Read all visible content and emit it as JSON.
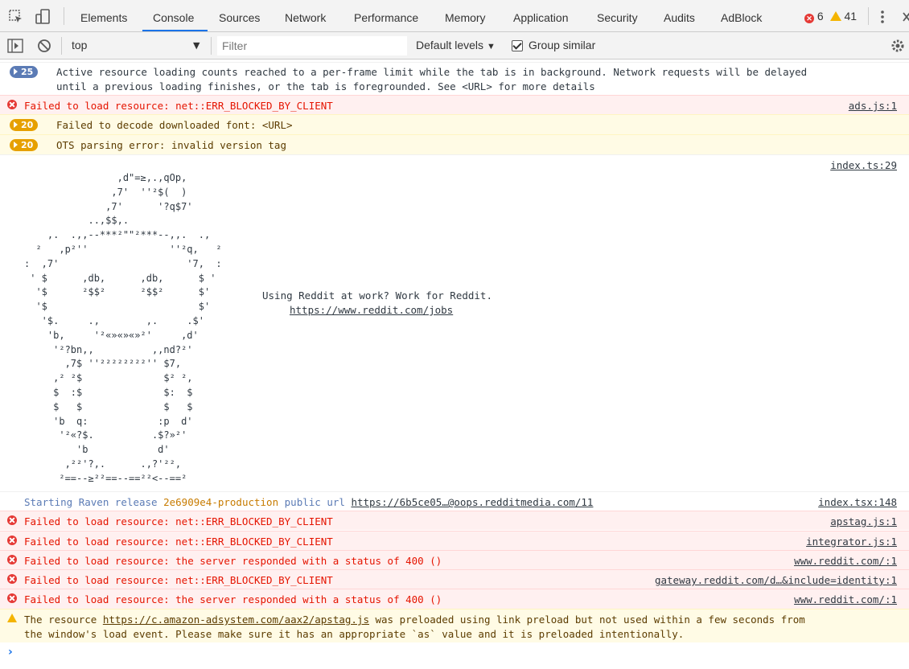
{
  "tabs": [
    {
      "label": "Elements"
    },
    {
      "label": "Console"
    },
    {
      "label": "Sources"
    },
    {
      "label": "Network"
    },
    {
      "label": "Performance"
    },
    {
      "label": "Memory"
    },
    {
      "label": "Application"
    },
    {
      "label": "Security"
    },
    {
      "label": "Audits"
    },
    {
      "label": "AdBlock"
    }
  ],
  "active_tab": "Console",
  "counts": {
    "errors": "6",
    "warnings": "41"
  },
  "toolbar": {
    "context": "top",
    "filter_placeholder": "Filter",
    "levels": "Default levels",
    "group_similar": "Group similar",
    "group_similar_checked": true
  },
  "messages": {
    "m1": {
      "count": "25",
      "text": "Active resource loading counts reached to a per-frame limit while the tab is in background. Network requests will be delayed\nuntil a previous loading finishes, or the tab is foregrounded. See <URL> for more details"
    },
    "m2": {
      "text": "Failed to load resource: net::ERR_BLOCKED_BY_CLIENT",
      "source": "ads.js:1"
    },
    "m3": {
      "count": "20",
      "text": "Failed to decode downloaded font: <URL>"
    },
    "m4": {
      "count": "20",
      "text": "OTS parsing error: invalid version tag"
    },
    "m5": {
      "source": "index.ts:29",
      "ascii": "                ,d\"=≥,.,qOp,\n               ,7'  ''²$(  )\n              ,7'      '?q$7'\n           ..,$$,.\n    ,.  .,,--***²\"\"²***--,,.  .,\n  ²   ,p²''              ''²q,   ²\n:  ,7'                      '7,  :\n ' $      ,db,      ,db,      $ '\n  '$      ²$$²      ²$$²      $'\n  '$                          $'\n   '$.     .,        ,.     .$'\n    'b,     '²«»«»«»²'     ,d'\n     '²?bn,,          ,,nd?²'\n       ,7$ ''²²²²²²²²'' $7,\n     ,² ²$              $² ²,\n     $  :$              $:  $\n     $   $              $   $\n     'b  q:            :p  d'\n      '²«?$.          .$?»²'\n         'b            d'\n       ,²²'?,.      .,?'²²,\n      ²==--≥²²==--==²²<--==²",
      "line1": "Using Reddit at work? Work for Reddit.",
      "link": "https://www.reddit.com/jobs"
    },
    "m6": {
      "w1": "Starting Raven release",
      "release": "2e6909e4-production",
      "w2": "public url",
      "url": "https://6b5ce05…@oops.redditmedia.com/11",
      "source": "index.tsx:148"
    },
    "m7": {
      "text": "Failed to load resource: net::ERR_BLOCKED_BY_CLIENT",
      "source": "apstag.js:1"
    },
    "m8": {
      "text": "Failed to load resource: net::ERR_BLOCKED_BY_CLIENT",
      "source": "integrator.js:1"
    },
    "m9": {
      "text": "Failed to load resource: the server responded with a status of 400 ()",
      "source": "www.reddit.com/:1"
    },
    "m10": {
      "text": "Failed to load resource: net::ERR_BLOCKED_BY_CLIENT",
      "source": "gateway.reddit.com/d…&include=identity:1"
    },
    "m11": {
      "text": "Failed to load resource: the server responded with a status of 400 ()",
      "source": "www.reddit.com/:1"
    },
    "m12": {
      "pre": "The resource ",
      "url": "https://c.amazon-adsystem.com/aax2/apstag.js",
      "post": " was preloaded using link preload but not used within a few seconds from\nthe window's load event. Please make sure it has an appropriate `as` value and it is preloaded intentionally."
    }
  },
  "prompt": "›",
  "colors": {
    "accent": "#1a73e8",
    "error": "#e51400",
    "error_bg": "#fff0f0",
    "warn_bg": "#fffbe5",
    "info_badge": "#5b7bb5",
    "warn_badge": "#e6a000"
  }
}
